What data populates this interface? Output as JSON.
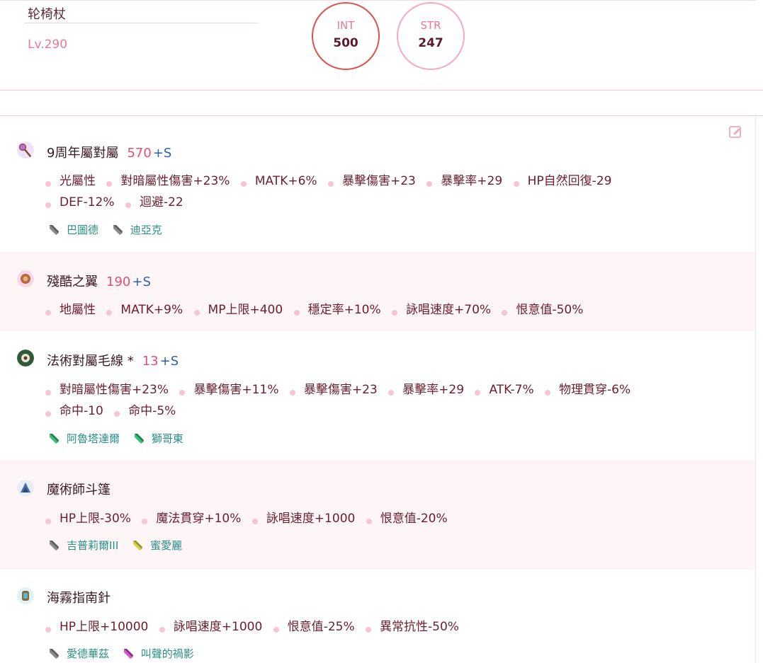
{
  "character": {
    "name": "轮椅杖",
    "level": "Lv.290"
  },
  "stats": [
    {
      "label": "INT",
      "value": "500"
    },
    {
      "label": "STR",
      "value": "247"
    }
  ],
  "equipment": [
    {
      "name": "9周年屬對屬",
      "refine": "570",
      "slot": "+S",
      "attr_lines": [
        [
          "光屬性",
          "對暗屬性傷害+23%",
          "MATK+6%",
          "暴擊傷害+23",
          "暴擊率+29",
          "HP自然回復-29"
        ],
        [
          "DEF-12%",
          "迴避-22"
        ]
      ],
      "cards": [
        "巴圖德",
        "迪亞克"
      ]
    },
    {
      "name": "殘酷之翼",
      "refine": "190",
      "slot": "+S",
      "attr_lines": [
        [
          "地屬性",
          "MATK+9%",
          "MP上限+400",
          "穩定率+10%",
          "詠唱速度+70%",
          "恨意值-50%"
        ]
      ],
      "cards": []
    },
    {
      "name": "法術對屬毛線 *",
      "refine": "13",
      "slot": "+S",
      "attr_lines": [
        [
          "對暗屬性傷害+23%",
          "暴擊傷害+11%",
          "暴擊傷害+23",
          "暴擊率+29",
          "ATK-7%",
          "物理貫穿-6%"
        ],
        [
          "命中-10",
          "命中-5%"
        ]
      ],
      "cards": [
        "阿魯塔達爾",
        "獅哥東"
      ]
    },
    {
      "name": "魔術師斗篷",
      "refine": "",
      "slot": "",
      "attr_lines": [
        [
          "HP上限-30%",
          "魔法貫穿+10%",
          "詠唱速度+1000",
          "恨意值-20%"
        ]
      ],
      "cards": [
        "吉普莉爾III",
        "蜜愛麗"
      ]
    },
    {
      "name": "海霧指南針",
      "refine": "",
      "slot": "",
      "attr_lines": [
        [
          "HP上限+10000",
          "詠唱速度+1000",
          "恨意值-25%",
          "異常抗性-50%"
        ]
      ],
      "cards": [
        "愛德華茲",
        "叫聲的禍影"
      ]
    }
  ],
  "colors": {
    "accent": "#e0507a",
    "slot": "#2b5fb8",
    "card": "#2a8f86",
    "int_ring": "#d9534f",
    "str_ring": "#f6a9bf"
  }
}
